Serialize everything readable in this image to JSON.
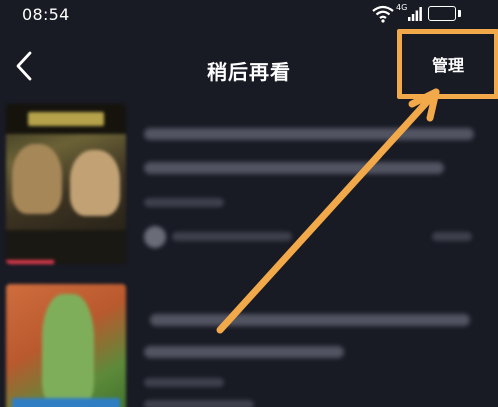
{
  "status_bar": {
    "time": "08:54",
    "network_label": "4G",
    "battery_level": "71",
    "icons": [
      "wifi-icon",
      "signal-icon",
      "battery-icon"
    ]
  },
  "header": {
    "back_icon": "chevron-left-icon",
    "title": "稍后再看",
    "manage_label": "管理"
  },
  "annotation": {
    "highlight_color": "#f2a94a",
    "arrow_color": "#f2a94a"
  },
  "colors": {
    "background": "#181a24",
    "text": "#ffffff",
    "progress": "#e23a4d"
  }
}
